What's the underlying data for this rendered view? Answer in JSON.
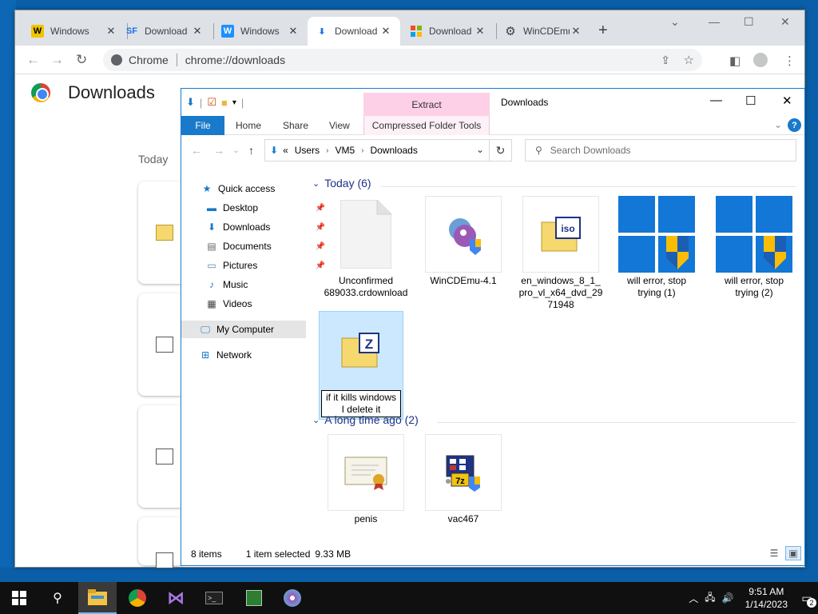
{
  "chrome": {
    "tabs": [
      {
        "title": "Windows",
        "favicon": "W"
      },
      {
        "title": "Download",
        "favicon": "SF"
      },
      {
        "title": "Windows",
        "favicon": "W"
      },
      {
        "title": "Download",
        "favicon": "download"
      },
      {
        "title": "Download",
        "favicon": "windows-logo"
      },
      {
        "title": "WinCDEmu",
        "favicon": "gear"
      }
    ],
    "omnibox_label": "Chrome",
    "url": "chrome://downloads",
    "page_title": "Downloads",
    "section_label": "Today"
  },
  "explorer": {
    "title": "Downloads",
    "extract_tab": "Extract",
    "ribbon": {
      "file": "File",
      "home": "Home",
      "share": "Share",
      "view": "View",
      "compressed_tools": "Compressed Folder Tools"
    },
    "address": {
      "prefix": "«",
      "segments": [
        "Users",
        "VM5",
        "Downloads"
      ]
    },
    "search_placeholder": "Search Downloads",
    "nav": {
      "quick_access": "Quick access",
      "desktop": "Desktop",
      "downloads": "Downloads",
      "documents": "Documents",
      "pictures": "Pictures",
      "music": "Music",
      "videos": "Videos",
      "my_computer": "My Computer",
      "network": "Network"
    },
    "groups": {
      "today": "Today (6)",
      "long_ago": "A long time ago (2)"
    },
    "files": {
      "f1": "Unconfirmed 689033.crdownload",
      "f2": "WinCDEmu-4.1",
      "f3": "en_windows_8_1_pro_vl_x64_dvd_2971948",
      "f4": "will error, stop trying (1)",
      "f5": "will error, stop trying (2)",
      "f6_rename": "if it kills windows I delete it",
      "f7": "penis",
      "f8": "vac467"
    },
    "status": {
      "items": "8 items",
      "selected": "1 item selected",
      "size": "9.33 MB"
    }
  },
  "taskbar": {
    "time": "9:51 AM",
    "date": "1/14/2023",
    "notification_count": "2"
  },
  "colors": {
    "accent": "#1979ca",
    "selection": "#cce8ff",
    "extract_tab": "#fdd0e7",
    "desktop": "#0a5fa8",
    "group_header": "#1e3287"
  }
}
